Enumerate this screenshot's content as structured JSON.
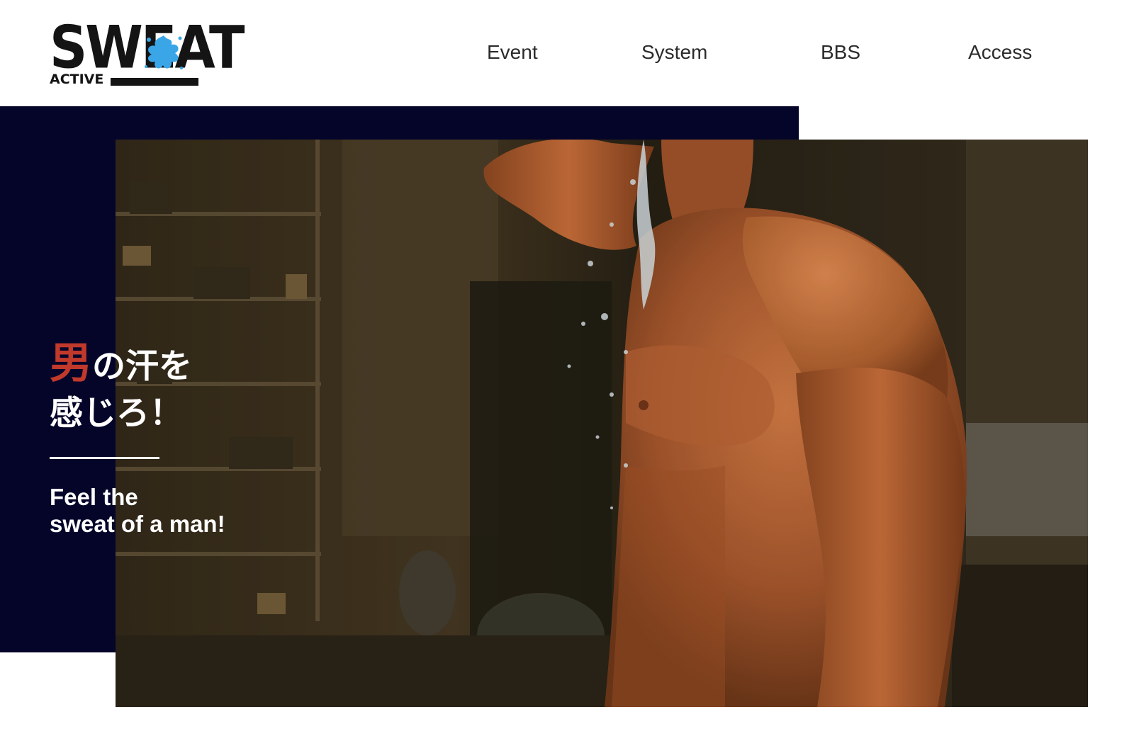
{
  "brand": {
    "logo_word": "SWEAT",
    "logo_sub": "ACTIVE",
    "colors": {
      "logo_ink": "#141414",
      "splash": "#3aa6e8"
    }
  },
  "nav": {
    "items": [
      {
        "label": "Event"
      },
      {
        "label": "System"
      },
      {
        "label": "BBS"
      },
      {
        "label": "Access"
      }
    ]
  },
  "hero": {
    "headline_accent": "男",
    "headline_rest_line1": "の汗を",
    "headline_line2": "感じろ！",
    "subtitle_line1": "Feel the",
    "subtitle_line2": "sweat of a man!",
    "image": "muscular-man-water-splash-photo",
    "colors": {
      "panel": "#05052a",
      "accent": "#c0392b",
      "text": "#ffffff"
    }
  }
}
